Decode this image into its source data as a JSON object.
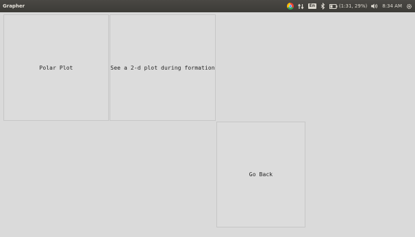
{
  "window": {
    "title": "Grapher"
  },
  "tray": {
    "icons": [
      "chrome-icon",
      "network-transfer-icon",
      "keyboard-layout-icon",
      "bluetooth-icon",
      "battery-icon",
      "volume-icon",
      "gear-icon"
    ],
    "keyboard_layout": "En",
    "battery_text": "(1:31, 29%)",
    "clock": "8:34 AM",
    "colors": {
      "panel": "#3c3b37",
      "chrome_red": "#e94235",
      "chrome_yellow": "#fbbc04",
      "chrome_green": "#34a853",
      "chrome_blue": "#4285f4"
    }
  },
  "buttons": {
    "polar_plot": "Polar Plot",
    "formation_plot": "See a 2-d plot during formation",
    "go_back": "Go Back"
  }
}
